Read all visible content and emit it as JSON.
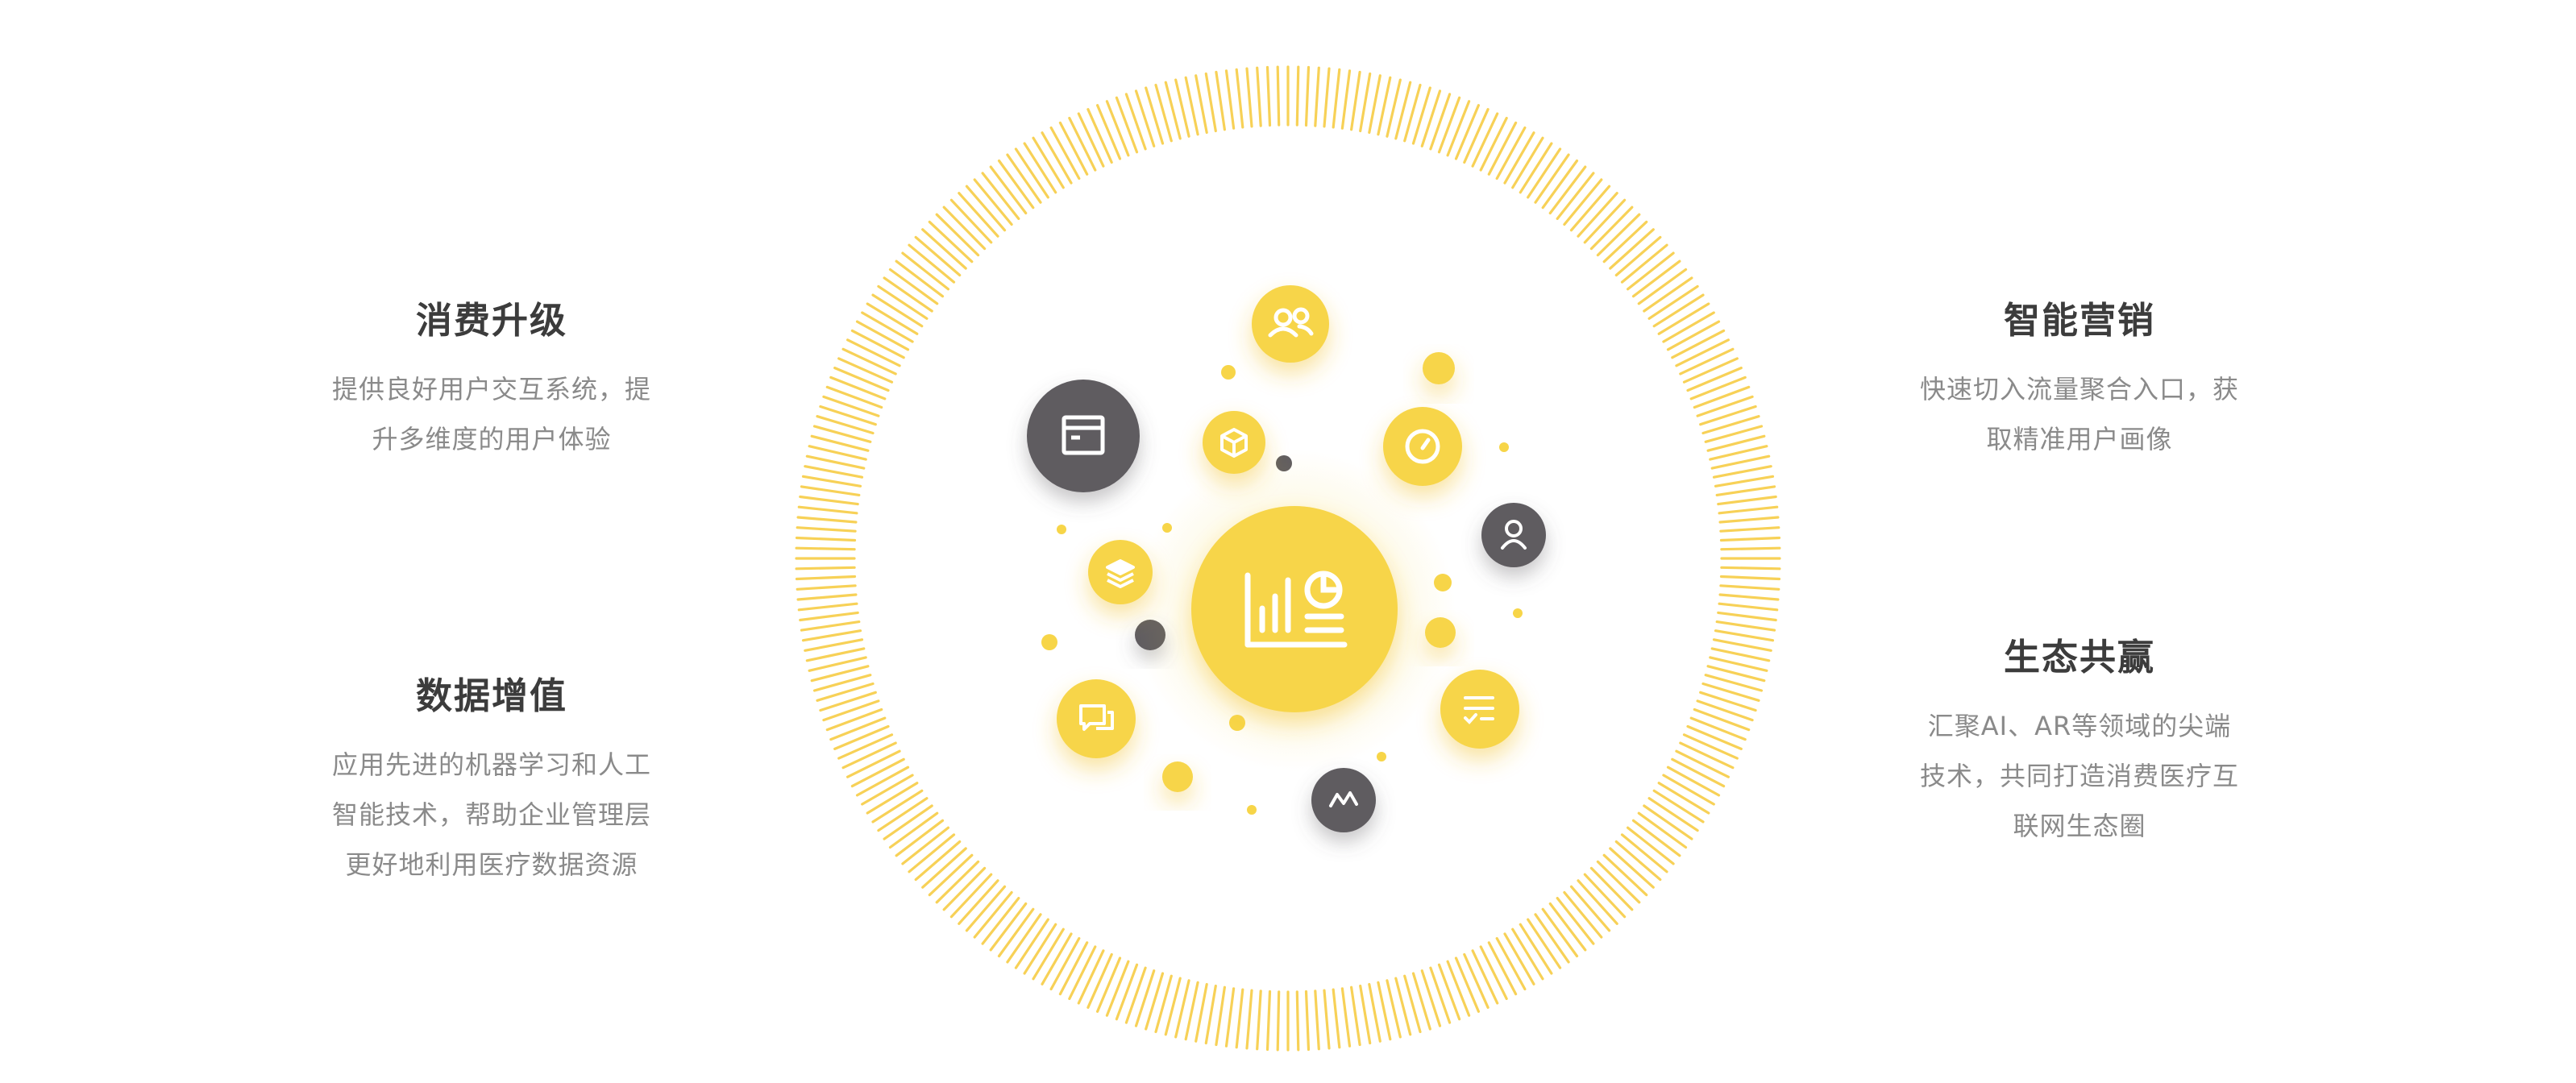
{
  "features": [
    {
      "title": "消费升级",
      "desc_lines": [
        "提供良好用户交互系统，提",
        "升多维度的用户体验"
      ]
    },
    {
      "title": "数据增值",
      "desc_lines": [
        "应用先进的机器学习和人工",
        "智能技术，帮助企业管理层",
        "更好地利用医疗数据资源"
      ]
    },
    {
      "title": "智能营销",
      "desc_lines": [
        "快速切入流量聚合入口，获",
        "取精准用户画像"
      ]
    },
    {
      "title": "生态共赢",
      "desc_lines": [
        "汇聚AI、AR等领域的尖端",
        "技术，共同打造消费医疗互",
        "联网生态圈"
      ]
    }
  ],
  "colors": {
    "accent_yellow": "#f7d548",
    "ring_yellow": "#f6c93a",
    "dark_gray": "#5e5b60",
    "title_text": "#3c3c3c",
    "desc_text": "#8a8a8a"
  },
  "icons": {
    "center": "bar-pie-chart-icon",
    "bubbles": [
      "users-icon",
      "browser-window-icon",
      "cube-icon",
      "gauge-icon",
      "user-icon",
      "layers-icon",
      "chat-icon",
      "checklist-icon",
      "activity-icon"
    ]
  }
}
